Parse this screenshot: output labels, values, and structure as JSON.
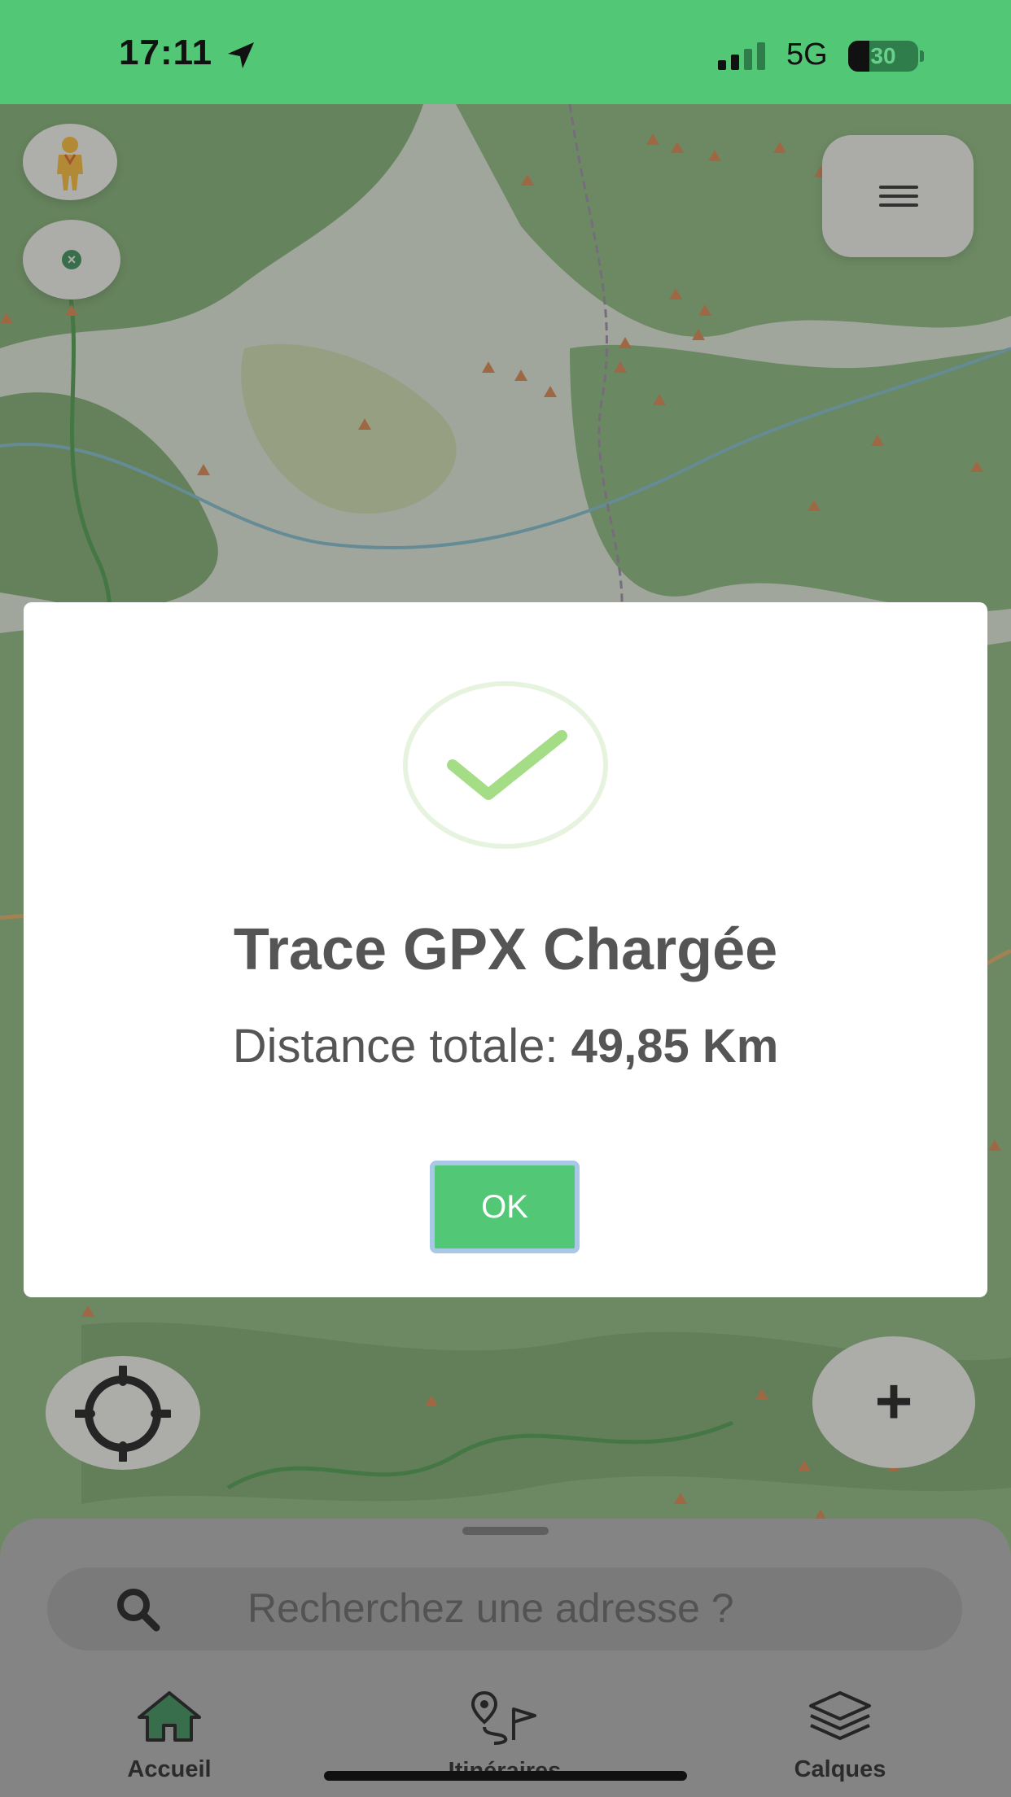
{
  "status_bar": {
    "time": "17:11",
    "network": "5G",
    "battery_percent": "30",
    "battery_level": 0.3,
    "background_color": "#52c877"
  },
  "map_controls": {
    "pegman_icon": "street-view-pegman",
    "clear_icon": "close-circle",
    "menu_icon": "hamburger-menu",
    "locate_icon": "crosshair-locate",
    "zoom_label": "+"
  },
  "dialog": {
    "icon": "success-checkmark",
    "title": "Trace GPX Chargée",
    "distance_label": "Distance totale: ",
    "distance_value": "49,85 Km",
    "ok_label": "OK",
    "accent_color": "#52c877"
  },
  "search": {
    "placeholder": "Recherchez une adresse ?"
  },
  "bottom_nav": {
    "items": [
      {
        "label": "Accueil",
        "icon": "home-icon"
      },
      {
        "label": "Itinéraires",
        "icon": "route-icon"
      },
      {
        "label": "Calques",
        "icon": "layers-icon"
      }
    ]
  }
}
